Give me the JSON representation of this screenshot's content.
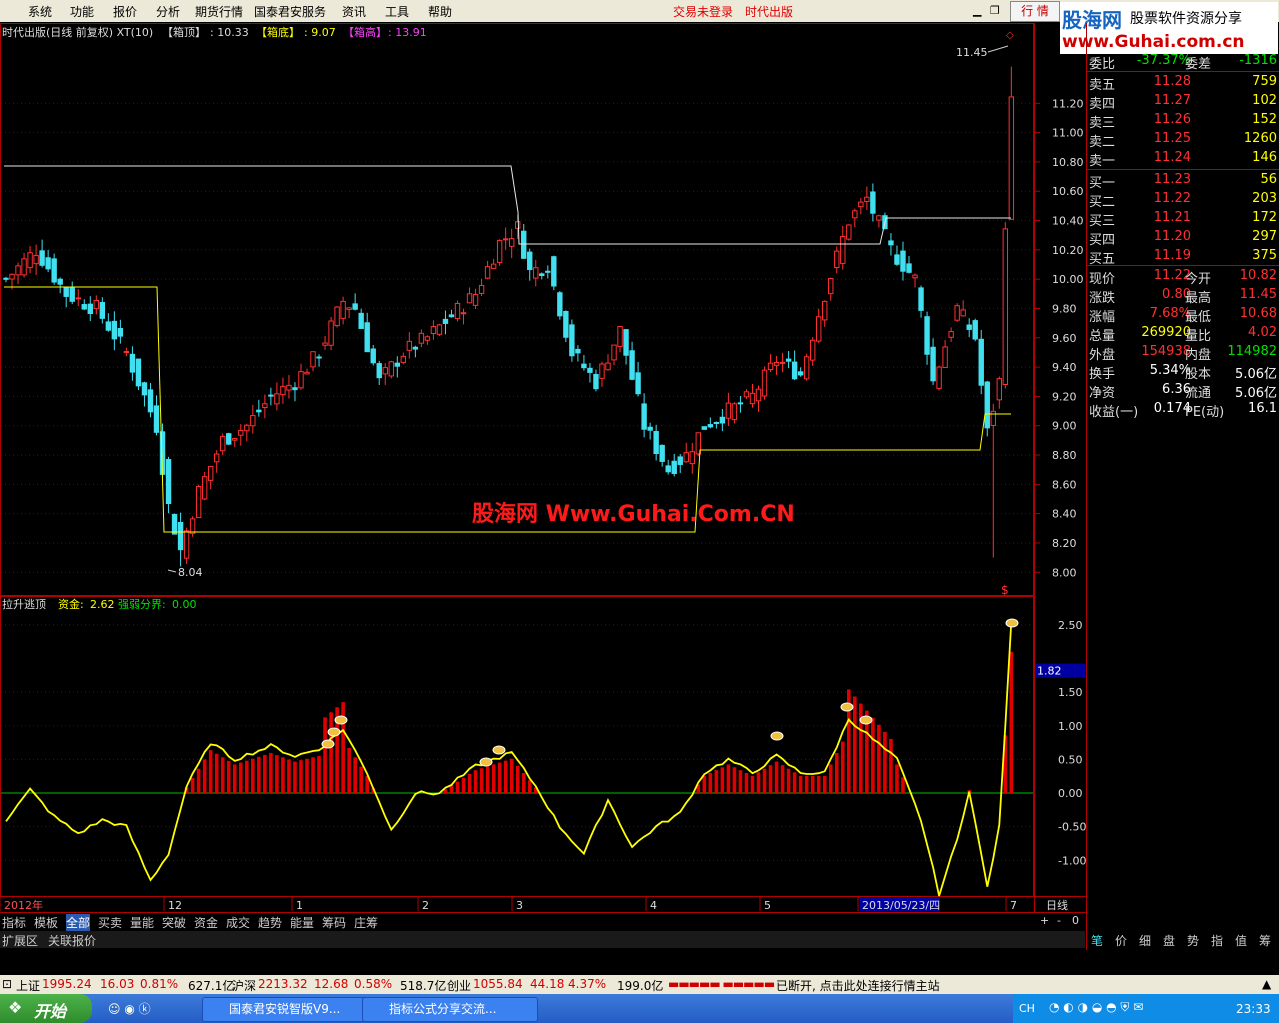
{
  "menu": {
    "items": [
      "系统",
      "功能",
      "报价",
      "分析",
      "期货行情",
      "国泰君安服务",
      "资讯",
      "工具",
      "帮助"
    ],
    "status_left": "交易未登录",
    "status_right": "时代出版",
    "tab": "行 情"
  },
  "logo": {
    "name": "股海网",
    "slogan": "股票软件资源分享",
    "url": "www.Guhai.com.cn"
  },
  "watermark": "股海网 Www.Guhai.Com.CN",
  "main_chart": {
    "title": "时代出版(日线 前复权) XT(10)",
    "box_top_label": "【箱顶】",
    "box_top_value": ": 10.33",
    "box_bottom_label": "【箱底】",
    "box_bottom_value": ": 9.07",
    "box_high_label": "【箱高】",
    "box_high_value": ": 13.91",
    "high_marker": "11.45",
    "low_marker": "8.04",
    "y_ticks": [
      "11.20",
      "11.00",
      "10.80",
      "10.60",
      "10.40",
      "10.20",
      "10.00",
      "9.80",
      "9.60",
      "9.40",
      "9.20",
      "9.00",
      "8.80",
      "8.60",
      "8.40",
      "8.20",
      "8.00"
    ],
    "y_range": [
      7.92,
      11.55
    ]
  },
  "indicator": {
    "title": "拉升逃顶",
    "fund_label": "资金: ",
    "fund_value": "2.62",
    "bound_label": "强弱分界: ",
    "bound_value": "0.00",
    "y_ticks": [
      "2.50",
      "1.82",
      "1.50",
      "1.00",
      "0.50",
      "0.00",
      "-0.50",
      "-1.00"
    ],
    "y_range": [
      -1.5,
      2.75
    ],
    "current_marker": "1.82"
  },
  "x_axis": {
    "labels": [
      "2012年",
      "12",
      "1",
      "2",
      "3",
      "4",
      "5",
      "2013/05/23/四",
      "7"
    ],
    "period": "日线",
    "controls": [
      "+",
      "-",
      "0"
    ]
  },
  "quote": {
    "top_labels": [
      "委比",
      "委差"
    ],
    "top_values": [
      "-37.37%",
      "-1316"
    ],
    "sell": [
      {
        "label": "卖五",
        "price": "11.28",
        "vol": "759"
      },
      {
        "label": "卖四",
        "price": "11.27",
        "vol": "102"
      },
      {
        "label": "卖三",
        "price": "11.26",
        "vol": "152"
      },
      {
        "label": "卖二",
        "price": "11.25",
        "vol": "1260"
      },
      {
        "label": "卖一",
        "price": "11.24",
        "vol": "146"
      }
    ],
    "buy": [
      {
        "label": "买一",
        "price": "11.23",
        "vol": "56"
      },
      {
        "label": "买二",
        "price": "11.22",
        "vol": "203"
      },
      {
        "label": "买三",
        "price": "11.21",
        "vol": "172"
      },
      {
        "label": "买四",
        "price": "11.20",
        "vol": "297"
      },
      {
        "label": "买五",
        "price": "11.19",
        "vol": "375"
      }
    ],
    "stats": [
      {
        "l1": "现价",
        "v1": "11.22",
        "l2": "今开",
        "v2": "10.82"
      },
      {
        "l1": "涨跌",
        "v1": "0.80",
        "l2": "最高",
        "v2": "11.45"
      },
      {
        "l1": "涨幅",
        "v1": "7.68%",
        "l2": "最低",
        "v2": "10.68"
      },
      {
        "l1": "总量",
        "v1": "269920",
        "l2": "量比",
        "v2": "4.02"
      },
      {
        "l1": "外盘",
        "v1": "154938",
        "l2": "内盘",
        "v2": "114982"
      },
      {
        "l1": "换手",
        "v1": "5.34%",
        "l2": "股本",
        "v2": "5.06亿"
      },
      {
        "l1": "净资",
        "v1": "6.36",
        "l2": "流通",
        "v2": "5.06亿"
      },
      {
        "l1": "收益(一)",
        "v1": "0.174",
        "l2": "PE(动)",
        "v2": "16.1"
      }
    ]
  },
  "bottom_tabs": [
    "指标",
    "模板",
    "全部",
    "买卖",
    "量能",
    "突破",
    "资金",
    "成交",
    "趋势",
    "能量",
    "筹码",
    "庄筹"
  ],
  "bottom_tabs2": [
    "扩展区",
    "关联报价"
  ],
  "right_tabs": [
    "笔",
    "价",
    "细",
    "盘",
    "势",
    "指",
    "值",
    "筹"
  ],
  "status_bar": {
    "sh_label": "上证",
    "sh_val": "1995.24",
    "sh_chg": "16.03",
    "sh_pct": "0.81%",
    "sh_amt": "627.1亿",
    "sz_label": "沪深",
    "sz_val": "2213.32",
    "sz_chg": "12.68",
    "sz_pct": "0.58%",
    "sz_amt": "518.7亿",
    "cy_label": "创业",
    "cy_val": "1055.84",
    "cy_chg": "44.18",
    "cy_pct": "4.37%",
    "cy_amt": "199.0亿",
    "msg": "已断开, 点击此处连接行情主站"
  },
  "taskbar": {
    "start": "开始",
    "tasks": [
      "国泰君安锐智版V9...",
      "指标公式分享交流..."
    ],
    "lang": "CH",
    "clock": "23:33"
  },
  "colors": {
    "up": "#ff3030",
    "down": "#40e0f0",
    "yellow": "#ffff00",
    "grid": "#800000"
  }
}
